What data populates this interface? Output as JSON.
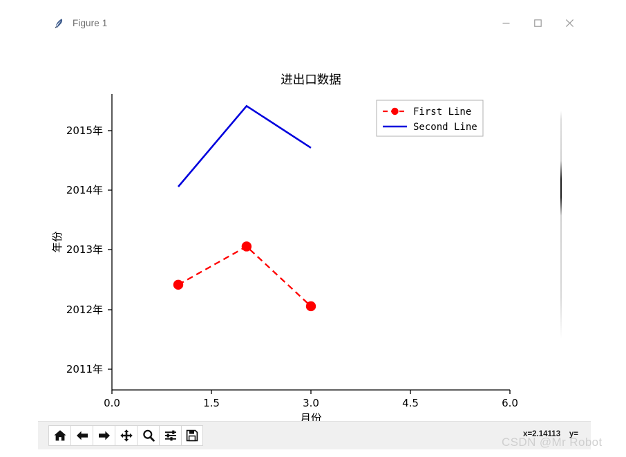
{
  "window": {
    "title": "Figure 1",
    "icon": "matplotlib-feather-icon",
    "controls": {
      "minimize": "minimize-icon",
      "maximize": "maximize-icon",
      "close": "close-icon"
    }
  },
  "toolbar": {
    "buttons": [
      {
        "name": "home-button",
        "icon": "home-icon",
        "tooltip": "Home"
      },
      {
        "name": "back-button",
        "icon": "arrow-left-icon",
        "tooltip": "Back"
      },
      {
        "name": "forward-button",
        "icon": "arrow-right-icon",
        "tooltip": "Forward"
      },
      {
        "name": "pan-button",
        "icon": "move-arrows-icon",
        "tooltip": "Pan"
      },
      {
        "name": "zoom-button",
        "icon": "magnifier-icon",
        "tooltip": "Zoom"
      },
      {
        "name": "configure-subplots-button",
        "icon": "sliders-icon",
        "tooltip": "Configure subplots"
      },
      {
        "name": "save-button",
        "icon": "floppy-disk-icon",
        "tooltip": "Save"
      }
    ],
    "coordinates": "x=2.14113    y="
  },
  "watermark": {
    "text": "CSDN @Mr Robot"
  },
  "chart_data": {
    "type": "line",
    "title": "进出口数据",
    "xlabel": "月份",
    "ylabel": "年份",
    "xlim": [
      0.0,
      6.0
    ],
    "ylim": [
      2010.6,
      2015.55
    ],
    "xticks": [
      0.0,
      1.5,
      3.0,
      4.5,
      6.0
    ],
    "xticklabels": [
      "0.0",
      "1.5",
      "3.0",
      "4.5",
      "6.0"
    ],
    "yticks": [
      2011,
      2012,
      2013,
      2014,
      2015
    ],
    "yticklabels": [
      "2011年",
      "2012年",
      "2013年",
      "2014年",
      "2015年"
    ],
    "grid": false,
    "legend": {
      "position": "upper right",
      "frame": true
    },
    "series": [
      {
        "name": "First Line",
        "color": "#ff0000",
        "linestyle": "dashed",
        "marker": "circle",
        "linewidth": 2,
        "x": [
          1.0,
          2.03,
          3.0
        ],
        "y": [
          2012.36,
          2013.0,
          2012.0
        ]
      },
      {
        "name": "Second Line",
        "color": "#0000dd",
        "linestyle": "solid",
        "marker": "none",
        "linewidth": 2.5,
        "x": [
          1.0,
          2.03,
          3.0
        ],
        "y": [
          2014.0,
          2015.35,
          2014.65
        ]
      }
    ]
  }
}
